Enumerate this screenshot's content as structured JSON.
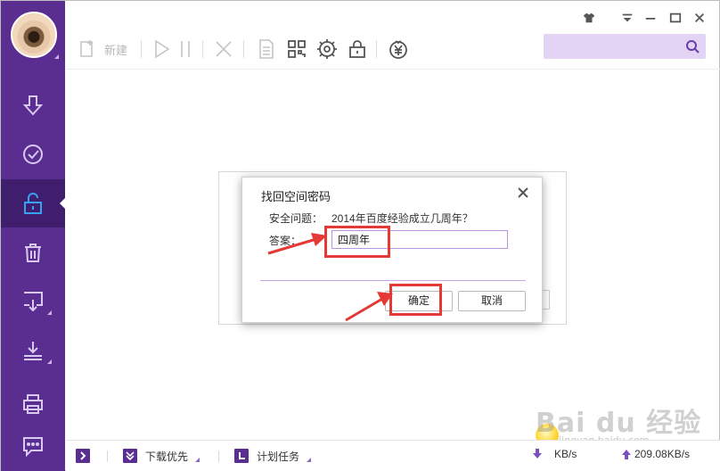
{
  "toolbar": {
    "new_label": "新建"
  },
  "dialog": {
    "title": "找回空间密码",
    "question_label": "安全问题：",
    "question_text": "2014年百度经验成立几周年？",
    "answer_label": "答案：",
    "answer_value": "四周年",
    "ok_label": "确定",
    "cancel_label": "取消"
  },
  "statusbar": {
    "download_priority": "下载优先",
    "scheduled_task": "计划任务",
    "down_speed": "KB/s",
    "up_speed": "209.08KB/s"
  },
  "watermark": {
    "brand": "Bai du 经验",
    "url": "jingyan.baidu.com"
  },
  "colors": {
    "sidebar": "#5a2d91",
    "sidebar_active": "#401e6e",
    "accent_light": "#e3d3f5",
    "annotation": "#e53935"
  },
  "icons": {
    "sidebar": [
      "download-icon",
      "completed-icon",
      "unlock-icon",
      "trash-icon",
      "import-icon",
      "export-icon",
      "print-icon",
      "chat-icon"
    ],
    "toolbar": [
      "new-icon",
      "play-icon",
      "pause-icon",
      "delete-icon",
      "file-icon",
      "qr-icon",
      "speed-icon",
      "lock-icon",
      "money-icon"
    ]
  }
}
